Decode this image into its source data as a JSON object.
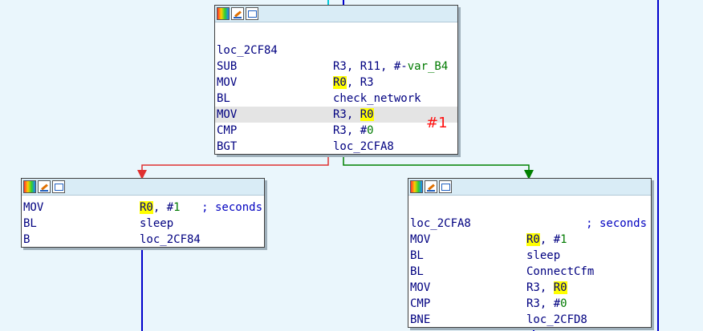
{
  "blocks": {
    "top": {
      "lines": [
        {
          "mn": "",
          "op": ""
        },
        {
          "mn": "loc_2CF84",
          "op": ""
        },
        {
          "mn": "SUB",
          "op": "R3, R11, #-var_B4"
        },
        {
          "mn": "MOV",
          "op": "R0, R3"
        },
        {
          "mn": "BL",
          "op": "check_network"
        },
        {
          "mn": "MOV",
          "op": "R3, R0"
        },
        {
          "mn": "CMP",
          "op": "R3, #0"
        },
        {
          "mn": "BGT",
          "op": "loc_2CFA8"
        }
      ]
    },
    "left": {
      "lines": [
        {
          "mn": "MOV",
          "op": "R0, #1",
          "comment": "; seconds"
        },
        {
          "mn": "BL",
          "op": "sleep"
        },
        {
          "mn": "B",
          "op": "loc_2CF84"
        }
      ]
    },
    "right": {
      "lines": [
        {
          "mn": "",
          "op": ""
        },
        {
          "mn": "loc_2CFA8",
          "op": "",
          "comment": "; seconds"
        },
        {
          "mn": "MOV",
          "op": "R0, #1"
        },
        {
          "mn": "BL",
          "op": "sleep"
        },
        {
          "mn": "BL",
          "op": "ConnectCfm"
        },
        {
          "mn": "MOV",
          "op": "R3, R0"
        },
        {
          "mn": "CMP",
          "op": "R3, #0"
        },
        {
          "mn": "BNE",
          "op": "loc_2CFD8"
        }
      ]
    }
  },
  "annotation": {
    "label": "#1",
    "color": "#ff1010"
  },
  "colors": {
    "edge_false": "#e03030",
    "edge_true": "#008000",
    "edge_flow": "#0000cc",
    "highlight": "#ffff00",
    "background": "#eaf6fc"
  }
}
